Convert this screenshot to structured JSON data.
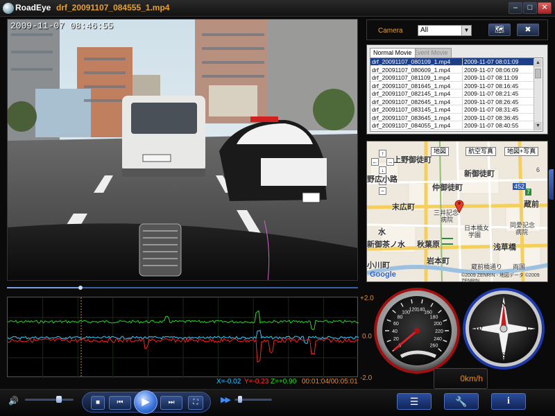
{
  "window": {
    "app_name": "RoadEye",
    "file_name": "drf_20091107_084555_1.mp4",
    "minimize": "–",
    "maximize": "□",
    "close": "✕"
  },
  "video": {
    "timestamp": "2009-11-07 08:46:55"
  },
  "seekbar": {
    "position_fraction": 0.21
  },
  "graph": {
    "ticks": [
      "+2.0",
      "0.0",
      "-2.0"
    ],
    "readout": {
      "x": "X=-0.02",
      "y": "Y=-0.23",
      "z": "Z=+0.90",
      "time": "00:01:04/00:05:01"
    },
    "colors": {
      "x": "#33c4ff",
      "y": "#ff2020",
      "z": "#22dd22",
      "marker": "#e8902a"
    }
  },
  "camera": {
    "label": "Camera",
    "selected": "All",
    "export_icon": "save-map-icon",
    "delete_icon": "delete-icon"
  },
  "file_list": {
    "tabs": [
      "Normal Movie",
      "Event Movie"
    ],
    "active_tab": "Normal Movie",
    "rows": [
      {
        "name": "drf_20091107_080109_1.mp4",
        "date": "2009-11-07 08:01:09"
      },
      {
        "name": "drf_20091107_080609_1.mp4",
        "date": "2009-11-07 08:06:09"
      },
      {
        "name": "drf_20091107_081109_1.mp4",
        "date": "2009-11-07 08:11:09"
      },
      {
        "name": "drf_20091107_081645_1.mp4",
        "date": "2009-11-07 08:16:45"
      },
      {
        "name": "drf_20091107_082145_1.mp4",
        "date": "2009-11-07 08:21:45"
      },
      {
        "name": "drf_20091107_082645_1.mp4",
        "date": "2009-11-07 08:26:45"
      },
      {
        "name": "drf_20091107_083145_1.mp4",
        "date": "2009-11-07 08:31:45"
      },
      {
        "name": "drf_20091107_083645_1.mp4",
        "date": "2009-11-07 08:36:45"
      },
      {
        "name": "drf_20091107_084055_1.mp4",
        "date": "2009-11-07 08:40:55"
      }
    ]
  },
  "map": {
    "buttons": {
      "map": "地図",
      "aerial": "航空写真",
      "hybrid": "地図+写真"
    },
    "labels": {
      "ueno": "上野御徒町",
      "shin_okachi": "新御徒町",
      "hirokoji": "野広小路",
      "nakaokachi": "仲御徒町",
      "suehirocho": "末広町",
      "kuramae": "蔵前",
      "sanjo": "三井記念",
      "sanjo2": "病院",
      "nihon": "日本橋女",
      "gakuen": "学園",
      "doai": "同愛記念",
      "byoin": "病院",
      "mizu": "水",
      "shin_ochanomizu": "新御茶ノ水",
      "akihabara": "秋葉原",
      "asakusabashi": "浅草橋",
      "iwamotocho": "岩本町",
      "ogawamachi": "小川町",
      "ryogoku": "両国",
      "kuramaebashi": "蔵前橋通り",
      "shield1": "452",
      "shield2": "6",
      "shield3": "7"
    },
    "logo": "Google",
    "copyright": "©2009 ZENRIN - 地図データ ©2009 ZENRIN"
  },
  "speedometer": {
    "ticks": [
      "0",
      "20",
      "40",
      "60",
      "80",
      "100",
      "120",
      "140",
      "160",
      "180",
      "200",
      "220",
      "240",
      "260"
    ],
    "speed_kmh": 0
  },
  "compass": {
    "labels": {
      "n": "N",
      "e": "E",
      "s": "S",
      "w": "W"
    }
  },
  "speed_display": "0km/h",
  "controls": {
    "volume_icon": "speaker-icon",
    "volume_fraction": 0.7,
    "stop": "■",
    "prev": "⏮",
    "play": "▶",
    "next": "⏭",
    "fullscreen": "⛶",
    "fast_forward": "▶▶",
    "speed_fraction": 0.1,
    "list_icon": "list-icon",
    "settings_icon": "wrench-icon",
    "info": "i"
  }
}
